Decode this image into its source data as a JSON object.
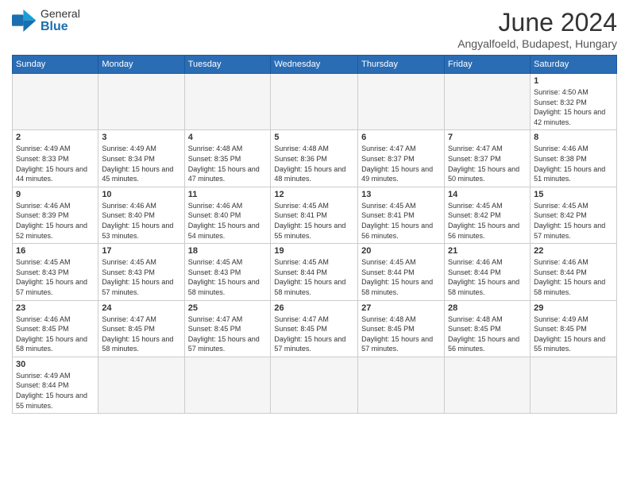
{
  "logo": {
    "text_general": "General",
    "text_blue": "Blue"
  },
  "title": "June 2024",
  "location": "Angyalfoeld, Budapest, Hungary",
  "days_header": [
    "Sunday",
    "Monday",
    "Tuesday",
    "Wednesday",
    "Thursday",
    "Friday",
    "Saturday"
  ],
  "weeks": [
    [
      {
        "day": "",
        "info": "",
        "empty": true
      },
      {
        "day": "",
        "info": "",
        "empty": true
      },
      {
        "day": "",
        "info": "",
        "empty": true
      },
      {
        "day": "",
        "info": "",
        "empty": true
      },
      {
        "day": "",
        "info": "",
        "empty": true
      },
      {
        "day": "",
        "info": "",
        "empty": true
      },
      {
        "day": "1",
        "info": "Sunrise: 4:50 AM\nSunset: 8:32 PM\nDaylight: 15 hours and 42 minutes."
      }
    ],
    [
      {
        "day": "2",
        "info": "Sunrise: 4:49 AM\nSunset: 8:33 PM\nDaylight: 15 hours and 44 minutes."
      },
      {
        "day": "3",
        "info": "Sunrise: 4:49 AM\nSunset: 8:34 PM\nDaylight: 15 hours and 45 minutes."
      },
      {
        "day": "4",
        "info": "Sunrise: 4:48 AM\nSunset: 8:35 PM\nDaylight: 15 hours and 47 minutes."
      },
      {
        "day": "5",
        "info": "Sunrise: 4:48 AM\nSunset: 8:36 PM\nDaylight: 15 hours and 48 minutes."
      },
      {
        "day": "6",
        "info": "Sunrise: 4:47 AM\nSunset: 8:37 PM\nDaylight: 15 hours and 49 minutes."
      },
      {
        "day": "7",
        "info": "Sunrise: 4:47 AM\nSunset: 8:37 PM\nDaylight: 15 hours and 50 minutes."
      },
      {
        "day": "8",
        "info": "Sunrise: 4:46 AM\nSunset: 8:38 PM\nDaylight: 15 hours and 51 minutes."
      }
    ],
    [
      {
        "day": "9",
        "info": "Sunrise: 4:46 AM\nSunset: 8:39 PM\nDaylight: 15 hours and 52 minutes."
      },
      {
        "day": "10",
        "info": "Sunrise: 4:46 AM\nSunset: 8:40 PM\nDaylight: 15 hours and 53 minutes."
      },
      {
        "day": "11",
        "info": "Sunrise: 4:46 AM\nSunset: 8:40 PM\nDaylight: 15 hours and 54 minutes."
      },
      {
        "day": "12",
        "info": "Sunrise: 4:45 AM\nSunset: 8:41 PM\nDaylight: 15 hours and 55 minutes."
      },
      {
        "day": "13",
        "info": "Sunrise: 4:45 AM\nSunset: 8:41 PM\nDaylight: 15 hours and 56 minutes."
      },
      {
        "day": "14",
        "info": "Sunrise: 4:45 AM\nSunset: 8:42 PM\nDaylight: 15 hours and 56 minutes."
      },
      {
        "day": "15",
        "info": "Sunrise: 4:45 AM\nSunset: 8:42 PM\nDaylight: 15 hours and 57 minutes."
      }
    ],
    [
      {
        "day": "16",
        "info": "Sunrise: 4:45 AM\nSunset: 8:43 PM\nDaylight: 15 hours and 57 minutes."
      },
      {
        "day": "17",
        "info": "Sunrise: 4:45 AM\nSunset: 8:43 PM\nDaylight: 15 hours and 57 minutes."
      },
      {
        "day": "18",
        "info": "Sunrise: 4:45 AM\nSunset: 8:43 PM\nDaylight: 15 hours and 58 minutes."
      },
      {
        "day": "19",
        "info": "Sunrise: 4:45 AM\nSunset: 8:44 PM\nDaylight: 15 hours and 58 minutes."
      },
      {
        "day": "20",
        "info": "Sunrise: 4:45 AM\nSunset: 8:44 PM\nDaylight: 15 hours and 58 minutes."
      },
      {
        "day": "21",
        "info": "Sunrise: 4:46 AM\nSunset: 8:44 PM\nDaylight: 15 hours and 58 minutes."
      },
      {
        "day": "22",
        "info": "Sunrise: 4:46 AM\nSunset: 8:44 PM\nDaylight: 15 hours and 58 minutes."
      }
    ],
    [
      {
        "day": "23",
        "info": "Sunrise: 4:46 AM\nSunset: 8:45 PM\nDaylight: 15 hours and 58 minutes."
      },
      {
        "day": "24",
        "info": "Sunrise: 4:47 AM\nSunset: 8:45 PM\nDaylight: 15 hours and 58 minutes."
      },
      {
        "day": "25",
        "info": "Sunrise: 4:47 AM\nSunset: 8:45 PM\nDaylight: 15 hours and 57 minutes."
      },
      {
        "day": "26",
        "info": "Sunrise: 4:47 AM\nSunset: 8:45 PM\nDaylight: 15 hours and 57 minutes."
      },
      {
        "day": "27",
        "info": "Sunrise: 4:48 AM\nSunset: 8:45 PM\nDaylight: 15 hours and 57 minutes."
      },
      {
        "day": "28",
        "info": "Sunrise: 4:48 AM\nSunset: 8:45 PM\nDaylight: 15 hours and 56 minutes."
      },
      {
        "day": "29",
        "info": "Sunrise: 4:49 AM\nSunset: 8:45 PM\nDaylight: 15 hours and 55 minutes."
      }
    ],
    [
      {
        "day": "30",
        "info": "Sunrise: 4:49 AM\nSunset: 8:44 PM\nDaylight: 15 hours and 55 minutes."
      },
      {
        "day": "",
        "info": "",
        "empty": true
      },
      {
        "day": "",
        "info": "",
        "empty": true
      },
      {
        "day": "",
        "info": "",
        "empty": true
      },
      {
        "day": "",
        "info": "",
        "empty": true
      },
      {
        "day": "",
        "info": "",
        "empty": true
      },
      {
        "day": "",
        "info": "",
        "empty": true
      }
    ]
  ]
}
